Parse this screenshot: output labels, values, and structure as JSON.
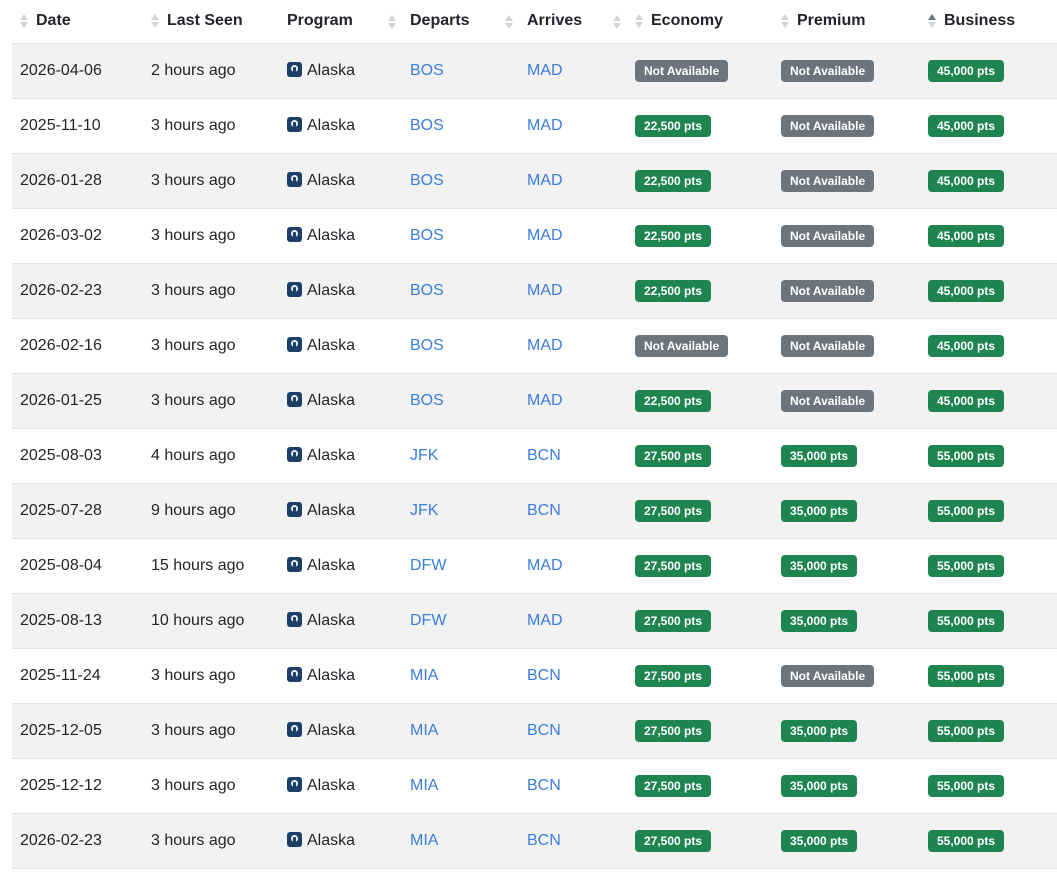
{
  "columns": [
    {
      "key": "date",
      "label": "Date"
    },
    {
      "key": "last_seen",
      "label": "Last Seen"
    },
    {
      "key": "program",
      "label": "Program"
    },
    {
      "key": "departs",
      "label": "Departs"
    },
    {
      "key": "arrives",
      "label": "Arrives"
    },
    {
      "key": "economy",
      "label": "Economy"
    },
    {
      "key": "premium",
      "label": "Premium"
    },
    {
      "key": "business",
      "label": "Business"
    }
  ],
  "sorted_column": "business",
  "colors": {
    "available": "#1e8551",
    "not_available": "#6c757d",
    "link": "#3b7ddd"
  },
  "program_icon": "alaska-airlines-logo-icon",
  "rows": [
    {
      "date": "2026-04-06",
      "last_seen": "2 hours ago",
      "program": "Alaska",
      "departs": "BOS",
      "arrives": "MAD",
      "economy": "Not Available",
      "premium": "Not Available",
      "business": "45,000 pts"
    },
    {
      "date": "2025-11-10",
      "last_seen": "3 hours ago",
      "program": "Alaska",
      "departs": "BOS",
      "arrives": "MAD",
      "economy": "22,500 pts",
      "premium": "Not Available",
      "business": "45,000 pts"
    },
    {
      "date": "2026-01-28",
      "last_seen": "3 hours ago",
      "program": "Alaska",
      "departs": "BOS",
      "arrives": "MAD",
      "economy": "22,500 pts",
      "premium": "Not Available",
      "business": "45,000 pts"
    },
    {
      "date": "2026-03-02",
      "last_seen": "3 hours ago",
      "program": "Alaska",
      "departs": "BOS",
      "arrives": "MAD",
      "economy": "22,500 pts",
      "premium": "Not Available",
      "business": "45,000 pts"
    },
    {
      "date": "2026-02-23",
      "last_seen": "3 hours ago",
      "program": "Alaska",
      "departs": "BOS",
      "arrives": "MAD",
      "economy": "22,500 pts",
      "premium": "Not Available",
      "business": "45,000 pts"
    },
    {
      "date": "2026-02-16",
      "last_seen": "3 hours ago",
      "program": "Alaska",
      "departs": "BOS",
      "arrives": "MAD",
      "economy": "Not Available",
      "premium": "Not Available",
      "business": "45,000 pts"
    },
    {
      "date": "2026-01-25",
      "last_seen": "3 hours ago",
      "program": "Alaska",
      "departs": "BOS",
      "arrives": "MAD",
      "economy": "22,500 pts",
      "premium": "Not Available",
      "business": "45,000 pts"
    },
    {
      "date": "2025-08-03",
      "last_seen": "4 hours ago",
      "program": "Alaska",
      "departs": "JFK",
      "arrives": "BCN",
      "economy": "27,500 pts",
      "premium": "35,000 pts",
      "business": "55,000 pts"
    },
    {
      "date": "2025-07-28",
      "last_seen": "9 hours ago",
      "program": "Alaska",
      "departs": "JFK",
      "arrives": "BCN",
      "economy": "27,500 pts",
      "premium": "35,000 pts",
      "business": "55,000 pts"
    },
    {
      "date": "2025-08-04",
      "last_seen": "15 hours ago",
      "program": "Alaska",
      "departs": "DFW",
      "arrives": "MAD",
      "economy": "27,500 pts",
      "premium": "35,000 pts",
      "business": "55,000 pts"
    },
    {
      "date": "2025-08-13",
      "last_seen": "10 hours ago",
      "program": "Alaska",
      "departs": "DFW",
      "arrives": "MAD",
      "economy": "27,500 pts",
      "premium": "35,000 pts",
      "business": "55,000 pts"
    },
    {
      "date": "2025-11-24",
      "last_seen": "3 hours ago",
      "program": "Alaska",
      "departs": "MIA",
      "arrives": "BCN",
      "economy": "27,500 pts",
      "premium": "Not Available",
      "business": "55,000 pts"
    },
    {
      "date": "2025-12-05",
      "last_seen": "3 hours ago",
      "program": "Alaska",
      "departs": "MIA",
      "arrives": "BCN",
      "economy": "27,500 pts",
      "premium": "35,000 pts",
      "business": "55,000 pts"
    },
    {
      "date": "2025-12-12",
      "last_seen": "3 hours ago",
      "program": "Alaska",
      "departs": "MIA",
      "arrives": "BCN",
      "economy": "27,500 pts",
      "premium": "35,000 pts",
      "business": "55,000 pts"
    },
    {
      "date": "2026-02-23",
      "last_seen": "3 hours ago",
      "program": "Alaska",
      "departs": "MIA",
      "arrives": "BCN",
      "economy": "27,500 pts",
      "premium": "35,000 pts",
      "business": "55,000 pts"
    }
  ]
}
